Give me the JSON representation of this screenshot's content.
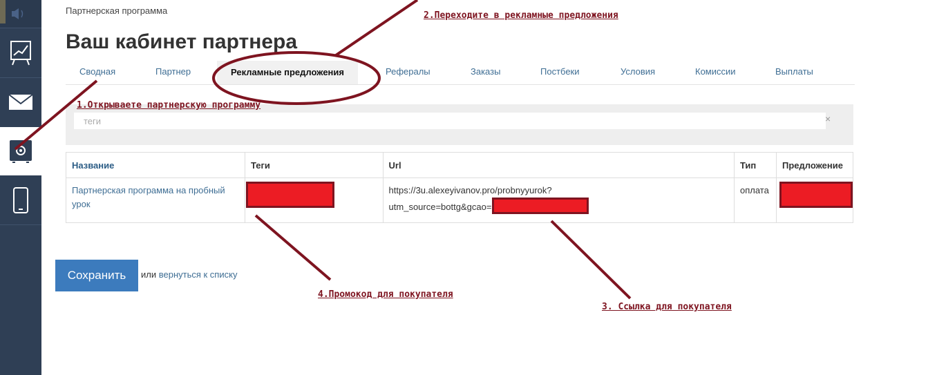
{
  "breadcrumb": "Партнерская программа",
  "page_title": "Ваш кабинет партнера",
  "tabs": [
    {
      "label": "Сводная"
    },
    {
      "label": "Партнер"
    },
    {
      "label": "Рекламные предложения",
      "active": true
    },
    {
      "label": "Рефералы"
    },
    {
      "label": "Заказы"
    },
    {
      "label": "Постбеки"
    },
    {
      "label": "Условия"
    },
    {
      "label": "Комиссии"
    },
    {
      "label": "Выплаты"
    }
  ],
  "filter": {
    "placeholder": "теги",
    "clear_symbol": "×"
  },
  "table": {
    "headers": [
      "Название",
      "Теги",
      "Url",
      "Тип",
      "Предложение"
    ],
    "rows": [
      {
        "name": "Партнерская программа на пробный урок",
        "tags": "",
        "url_line1": "https://3u.alexeyivanov.pro/probnyyurok?",
        "url_line2": "utm_source=bottg&gcao=",
        "type": "оплата",
        "offer": ""
      }
    ]
  },
  "actions": {
    "save_label": "Сохранить",
    "or_text": "или",
    "back_link": "вернуться к списку"
  },
  "annotations": {
    "step1": "1.Открываете партнерскую программу",
    "step2": "2.Переходите в рекламные предложения",
    "step3": "3. Ссылка для покупателя",
    "step4": "4.Промокод для покупателя"
  },
  "colors": {
    "sidebar": "#2f3f55",
    "accent": "#3c7bbd",
    "link": "#3f6e94",
    "annotation": "#7e1420",
    "redaction": "#ec1c24"
  },
  "sidebar_icons": [
    "speaker-icon",
    "chart-board-icon",
    "mail-icon",
    "safe-settings-icon",
    "phone-icon"
  ]
}
